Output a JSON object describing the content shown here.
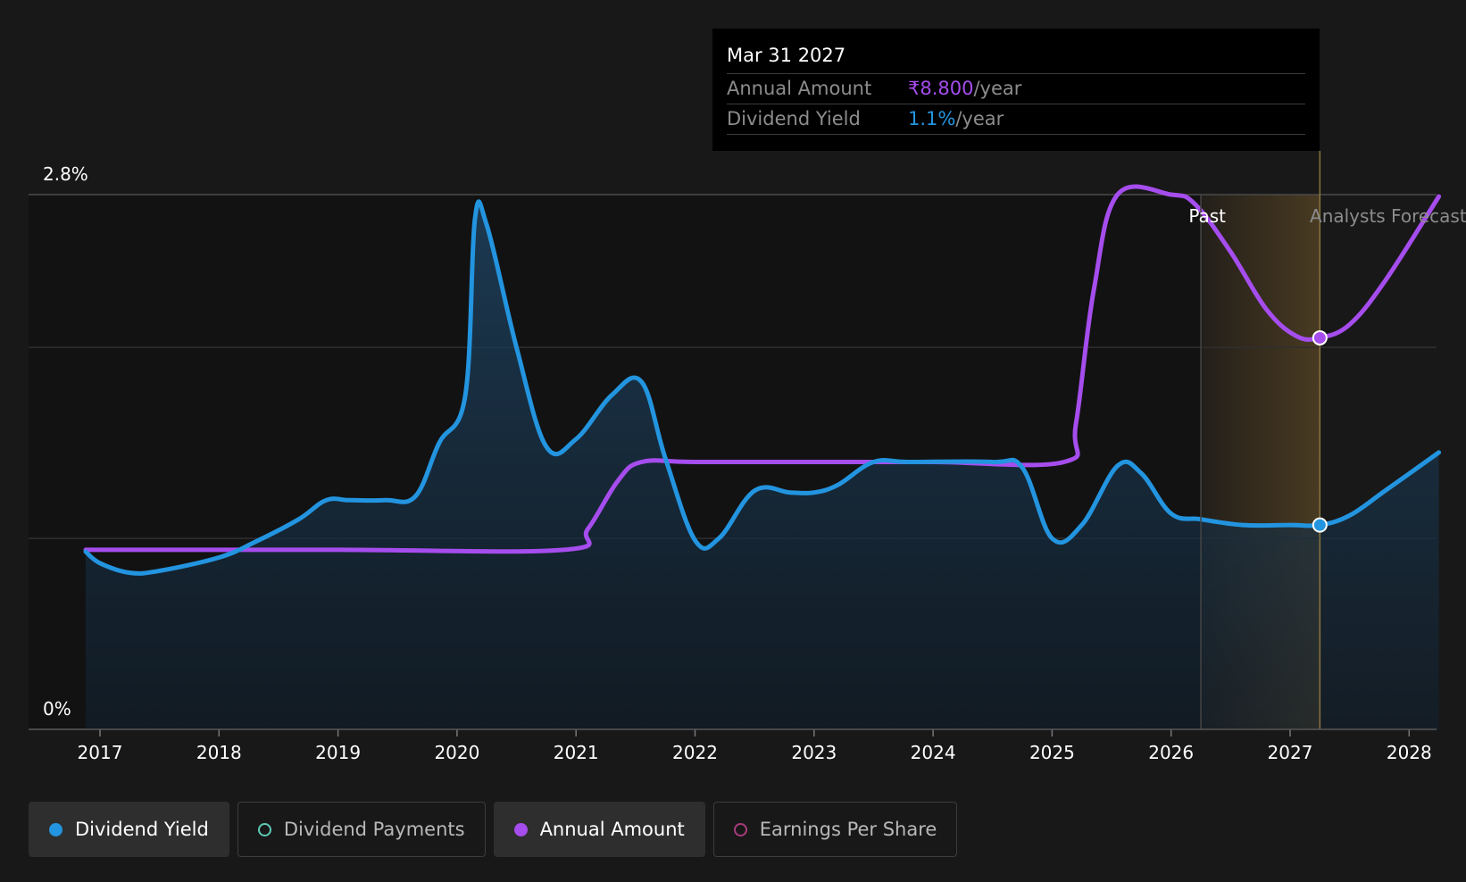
{
  "colors": {
    "background": "#181818",
    "dividend_yield": "#2394df",
    "annual_amount": "#a64dee",
    "dividend_payments": "#5fc9b5",
    "earnings_per_share": "#a83c7c",
    "forecast_band": "#7a5e2c"
  },
  "tooltip": {
    "date": "Mar 31 2027",
    "rows": [
      {
        "label": "Annual Amount",
        "value": "₹8.800",
        "unit": "/year",
        "color": "#a64dee"
      },
      {
        "label": "Dividend Yield",
        "value": "1.1%",
        "unit": "/year",
        "color": "#2394df"
      }
    ]
  },
  "legend": [
    {
      "label": "Dividend Yield",
      "icon": "filled-circle-icon",
      "color": "#2394df",
      "active": true
    },
    {
      "label": "Dividend Payments",
      "icon": "hollow-circle-icon",
      "color": "#5fc9b5",
      "active": false
    },
    {
      "label": "Annual Amount",
      "icon": "filled-circle-icon",
      "color": "#a64dee",
      "active": true
    },
    {
      "label": "Earnings Per Share",
      "icon": "hollow-circle-icon",
      "color": "#a83c7c",
      "active": false
    }
  ],
  "chart_data": {
    "type": "line",
    "title": "",
    "xlabel": "",
    "ylabel": "",
    "ylim": [
      0,
      2.8
    ],
    "y_ticks": [
      {
        "value": 2.8,
        "label": "2.8%"
      },
      {
        "value": 0,
        "label": "0%"
      }
    ],
    "y_gridlines": [
      0,
      1.0,
      2.0,
      2.8
    ],
    "xlim": [
      2016.9,
      2028.25
    ],
    "x_ticks": [
      "2017",
      "2018",
      "2019",
      "2020",
      "2021",
      "2022",
      "2023",
      "2024",
      "2025",
      "2026",
      "2027",
      "2028"
    ],
    "grid": true,
    "past_label": "Past",
    "forecast_label": "Analysts Forecasts",
    "forecast_start": 2026.25,
    "forecast_band_end": 2027.25,
    "marker_x": 2027.25,
    "series": [
      {
        "name": "Dividend Yield",
        "area_fill": true,
        "color": "#2394df",
        "points": [
          [
            2016.88,
            0.93
          ],
          [
            2017.0,
            0.87
          ],
          [
            2017.25,
            0.82
          ],
          [
            2017.5,
            0.83
          ],
          [
            2018.0,
            0.9
          ],
          [
            2018.3,
            0.98
          ],
          [
            2018.67,
            1.1
          ],
          [
            2018.9,
            1.2
          ],
          [
            2019.1,
            1.2
          ],
          [
            2019.4,
            1.2
          ],
          [
            2019.65,
            1.22
          ],
          [
            2019.85,
            1.5
          ],
          [
            2020.07,
            1.75
          ],
          [
            2020.15,
            2.67
          ],
          [
            2020.25,
            2.64
          ],
          [
            2020.5,
            2.0
          ],
          [
            2020.75,
            1.48
          ],
          [
            2021.0,
            1.52
          ],
          [
            2021.3,
            1.75
          ],
          [
            2021.55,
            1.82
          ],
          [
            2021.75,
            1.42
          ],
          [
            2022.0,
            0.99
          ],
          [
            2022.2,
            1.0
          ],
          [
            2022.5,
            1.25
          ],
          [
            2022.8,
            1.24
          ],
          [
            2023.0,
            1.24
          ],
          [
            2023.2,
            1.28
          ],
          [
            2023.5,
            1.4
          ],
          [
            2023.8,
            1.4
          ],
          [
            2024.5,
            1.4
          ],
          [
            2024.75,
            1.37
          ],
          [
            2025.0,
            1.0
          ],
          [
            2025.25,
            1.07
          ],
          [
            2025.55,
            1.38
          ],
          [
            2025.75,
            1.34
          ],
          [
            2026.0,
            1.13
          ],
          [
            2026.25,
            1.1
          ],
          [
            2026.6,
            1.07
          ],
          [
            2027.0,
            1.07
          ],
          [
            2027.25,
            1.07
          ],
          [
            2027.5,
            1.12
          ],
          [
            2027.8,
            1.25
          ],
          [
            2028.25,
            1.45
          ]
        ]
      },
      {
        "name": "Annual Amount",
        "area_fill": false,
        "color": "#a64dee",
        "points": [
          [
            2016.88,
            0.94
          ],
          [
            2019.0,
            0.94
          ],
          [
            2020.9,
            0.94
          ],
          [
            2021.1,
            1.05
          ],
          [
            2021.35,
            1.3
          ],
          [
            2021.55,
            1.4
          ],
          [
            2022.0,
            1.4
          ],
          [
            2023.0,
            1.4
          ],
          [
            2024.0,
            1.4
          ],
          [
            2025.1,
            1.4
          ],
          [
            2025.2,
            1.6
          ],
          [
            2025.35,
            2.3
          ],
          [
            2025.55,
            2.8
          ],
          [
            2026.0,
            2.8
          ],
          [
            2026.2,
            2.75
          ],
          [
            2026.5,
            2.5
          ],
          [
            2026.8,
            2.2
          ],
          [
            2027.05,
            2.06
          ],
          [
            2027.25,
            2.05
          ],
          [
            2027.5,
            2.12
          ],
          [
            2027.8,
            2.35
          ],
          [
            2028.25,
            2.79
          ]
        ]
      }
    ]
  }
}
